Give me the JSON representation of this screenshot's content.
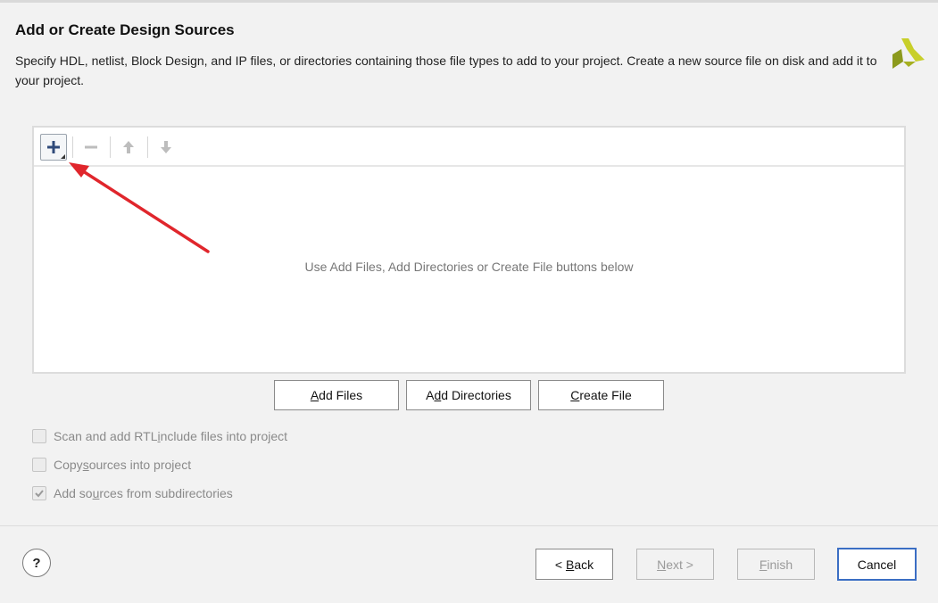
{
  "header": {
    "title": "Add or Create Design Sources",
    "description": "Specify HDL, netlist, Block Design, and IP files, or directories containing those file types to add to your project. Create a new source file on disk and add it to your project."
  },
  "toolbar": {
    "add_icon": "plus-icon",
    "remove_icon": "minus-icon",
    "up_icon": "arrow-up-icon",
    "down_icon": "arrow-down-icon"
  },
  "file_list": {
    "placeholder": "Use Add Files, Add Directories or Create File buttons below"
  },
  "actions": {
    "add_files": {
      "pre": "",
      "mnemonic": "A",
      "post": "dd Files"
    },
    "add_directories": {
      "pre": "A",
      "mnemonic": "d",
      "post": "d Directories"
    },
    "create_file": {
      "pre": "",
      "mnemonic": "C",
      "post": "reate File"
    }
  },
  "options": [
    {
      "pre": "Scan and add RTL ",
      "mnemonic": "i",
      "post": "nclude files into project",
      "checked": false
    },
    {
      "pre": "Copy ",
      "mnemonic": "s",
      "post": "ources into project",
      "checked": false
    },
    {
      "pre": "Add so",
      "mnemonic": "u",
      "post": "rces from subdirectories",
      "checked": true
    }
  ],
  "footer": {
    "help": "?",
    "back": {
      "pre": "< ",
      "mnemonic": "B",
      "post": "ack"
    },
    "next": {
      "pre": "",
      "mnemonic": "N",
      "post": "ext >"
    },
    "finish": {
      "pre": "",
      "mnemonic": "F",
      "post": "inish"
    },
    "cancel": "Cancel"
  },
  "colors": {
    "annotation_arrow": "#e0262c",
    "logo_yellow": "#c8cf2a",
    "logo_olive": "#8c9a1d",
    "default_button_border": "#3b6ec4"
  }
}
